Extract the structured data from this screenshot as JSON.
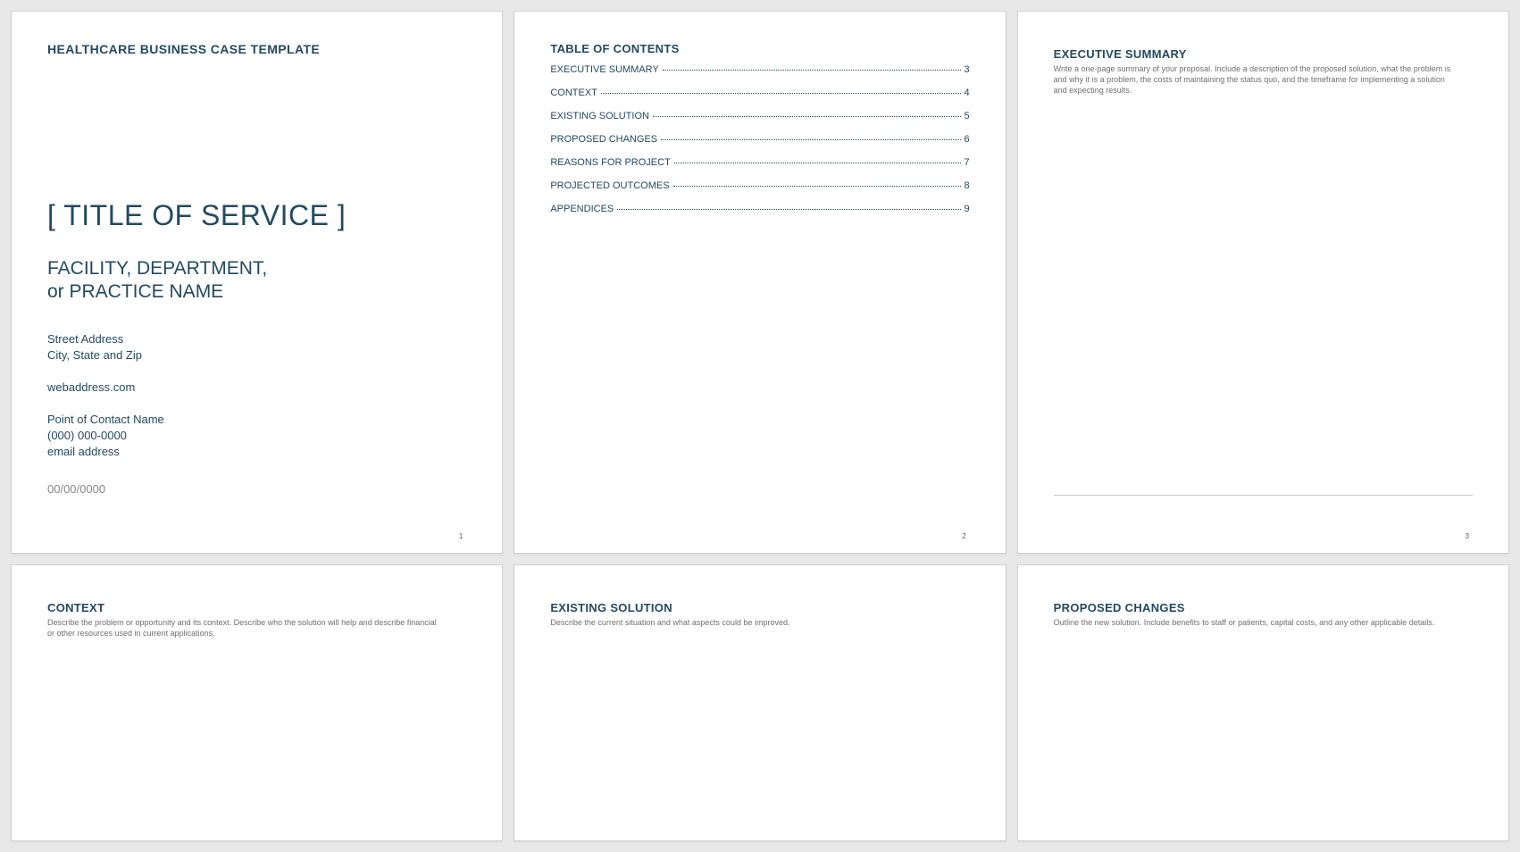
{
  "page1": {
    "template_name": "HEALTHCARE BUSINESS CASE TEMPLATE",
    "service_title": "[ TITLE OF SERVICE ]",
    "facility_line1": "FACILITY, DEPARTMENT,",
    "facility_line2": "or PRACTICE NAME",
    "street": "Street Address",
    "city": "City, State and Zip",
    "web": "webaddress.com",
    "contact_name": "Point of Contact Name",
    "phone": "(000) 000-0000",
    "email": "email address",
    "date": "00/00/0000",
    "page_no": "1"
  },
  "page2": {
    "heading": "TABLE OF CONTENTS",
    "items": [
      {
        "label": "EXECUTIVE SUMMARY",
        "page": "3"
      },
      {
        "label": "CONTEXT",
        "page": "4"
      },
      {
        "label": "EXISTING SOLUTION",
        "page": "5"
      },
      {
        "label": "PROPOSED CHANGES",
        "page": "6"
      },
      {
        "label": "REASONS FOR PROJECT",
        "page": "7"
      },
      {
        "label": "PROJECTED OUTCOMES",
        "page": "8"
      },
      {
        "label": "APPENDICES",
        "page": "9"
      }
    ],
    "page_no": "2"
  },
  "page3": {
    "heading": "EXECUTIVE SUMMARY",
    "desc": "Write a one-page summary of your proposal. Include a description of the proposed solution, what the problem is and why it is a problem, the costs of maintaining the status quo, and the timeframe for implementing a solution and expecting results.",
    "page_no": "3"
  },
  "page4": {
    "heading": "CONTEXT",
    "desc": "Describe the problem or opportunity and its context. Describe who the solution will help and describe financial or other resources used in current applications."
  },
  "page5": {
    "heading": "EXISTING SOLUTION",
    "desc": "Describe the current situation and what aspects could be improved."
  },
  "page6": {
    "heading": "PROPOSED CHANGES",
    "desc": "Outline the new solution. Include benefits to staff or patients, capital costs, and any other applicable details."
  }
}
